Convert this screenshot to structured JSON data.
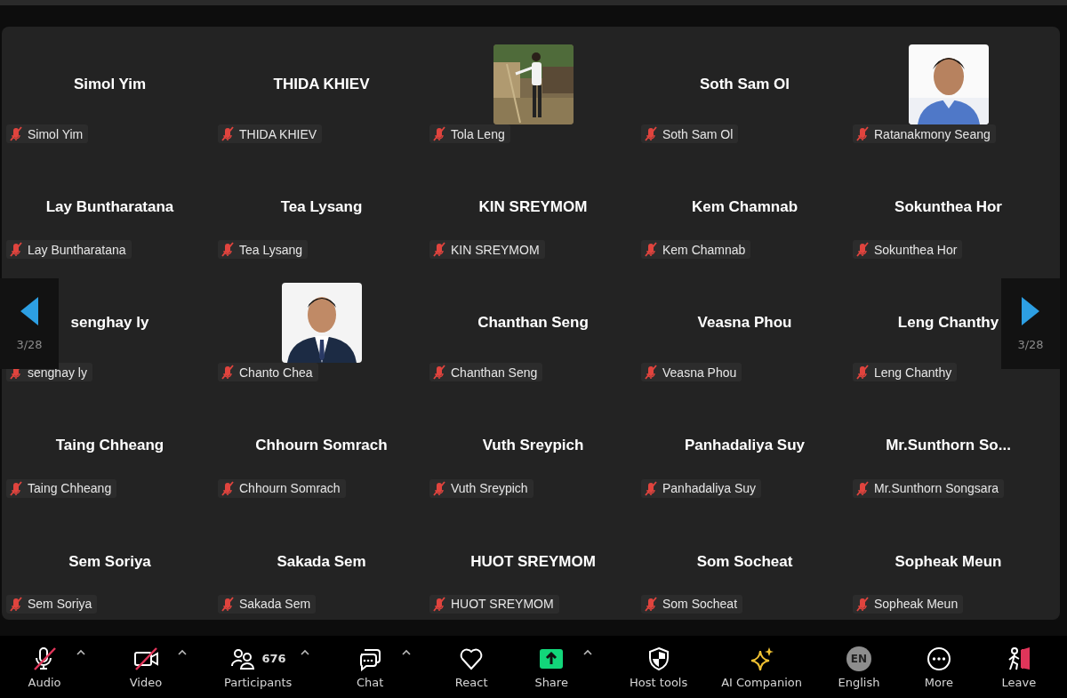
{
  "gallery": {
    "tiles": [
      {
        "kind": "name",
        "display_name": "Simol Yim",
        "nametag": "Simol Yim",
        "muted": true
      },
      {
        "kind": "name",
        "display_name": "THIDA KHIEV",
        "nametag": "THIDA KHIEV",
        "muted": true
      },
      {
        "nametag": "Tola Leng",
        "muted": true
      },
      {
        "kind": "name",
        "display_name": "Soth Sam Ol",
        "nametag": "Soth Sam Ol",
        "muted": true
      },
      {
        "nametag": "Ratanakmony Seang",
        "muted": true
      },
      {
        "kind": "name",
        "display_name": "Lay Buntharatana",
        "nametag": "Lay Buntharatana",
        "muted": true
      },
      {
        "kind": "name",
        "display_name": "Tea Lysang",
        "nametag": "Tea Lysang",
        "muted": true
      },
      {
        "kind": "name",
        "display_name": "KIN SREYMOM",
        "nametag": "KIN SREYMOM",
        "muted": true
      },
      {
        "kind": "name",
        "display_name": "Kem Chamnab",
        "nametag": "Kem Chamnab",
        "muted": true
      },
      {
        "kind": "name",
        "display_name": "Sokunthea Hor",
        "nametag": "Sokunthea Hor",
        "muted": true
      },
      {
        "kind": "name",
        "display_name": "senghay ly",
        "nametag": "senghay ly",
        "muted": true
      },
      {
        "nametag": "Chanto Chea",
        "muted": true
      },
      {
        "kind": "name",
        "display_name": "Chanthan Seng",
        "nametag": "Chanthan Seng",
        "muted": true
      },
      {
        "kind": "name",
        "display_name": "Veasna Phou",
        "nametag": "Veasna Phou",
        "muted": true
      },
      {
        "kind": "name",
        "display_name": "Leng Chanthy",
        "nametag": "Leng Chanthy",
        "muted": true
      },
      {
        "kind": "name",
        "display_name": "Taing Chheang",
        "nametag": "Taing Chheang",
        "muted": true
      },
      {
        "kind": "name",
        "display_name": "Chhourn Somrach",
        "nametag": "Chhourn Somrach",
        "muted": true
      },
      {
        "kind": "name",
        "display_name": "Vuth Sreypich",
        "nametag": "Vuth Sreypich",
        "muted": true
      },
      {
        "kind": "name",
        "display_name": "Panhadaliya Suy",
        "nametag": "Panhadaliya Suy",
        "muted": true
      },
      {
        "kind": "name",
        "display_name": "Mr.Sunthorn  So...",
        "nametag": "Mr.Sunthorn Songsara",
        "muted": true
      },
      {
        "kind": "name",
        "display_name": "Sem Soriya",
        "nametag": "Sem Soriya",
        "muted": true
      },
      {
        "kind": "name",
        "display_name": "Sakada Sem",
        "nametag": "Sakada Sem",
        "muted": true
      },
      {
        "kind": "name",
        "display_name": "HUOT SREYMOM",
        "nametag": "HUOT SREYMOM",
        "muted": true
      },
      {
        "kind": "name",
        "display_name": "Som Socheat",
        "nametag": "Som Socheat",
        "muted": true
      },
      {
        "kind": "name",
        "display_name": "Sopheak Meun",
        "nametag": "Sopheak Meun",
        "muted": true
      }
    ],
    "pager_left": {
      "page": "3/28"
    },
    "pager_right": {
      "page": "3/28"
    }
  },
  "toolbar": [
    {
      "kind": "audio",
      "label": "Audio",
      "off": true,
      "caret": true
    },
    {
      "kind": "video",
      "label": "Video",
      "off": true,
      "caret": true
    },
    {
      "kind": "participants",
      "label": "Participants",
      "count": "676",
      "caret": true
    },
    {
      "kind": "chat",
      "label": "Chat",
      "caret": true
    },
    {
      "kind": "react",
      "label": "React"
    },
    {
      "kind": "share",
      "label": "Share",
      "caret": true
    },
    {
      "kind": "host",
      "label": "Host tools"
    },
    {
      "kind": "ai",
      "label": "AI Companion"
    },
    {
      "kind": "language",
      "label": "English",
      "badge": "EN"
    },
    {
      "kind": "more",
      "label": "More"
    },
    {
      "kind": "leave",
      "label": "Leave"
    }
  ]
}
